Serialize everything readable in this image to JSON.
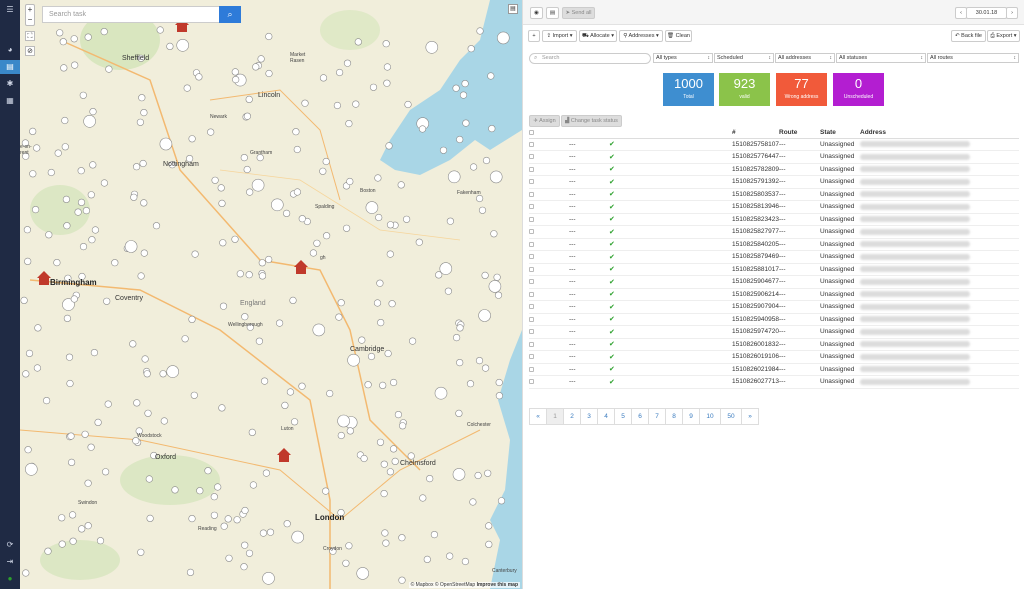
{
  "nav": {
    "icons": [
      "menu-icon",
      "globe-icon",
      "list-icon",
      "settings-icon",
      "calendar-icon",
      "refresh-icon",
      "logout-icon",
      "status-icon"
    ]
  },
  "map": {
    "search_placeholder": "Search task",
    "zoom_in": "+",
    "zoom_out": "−",
    "attribution": "© Mapbox © OpenStreetMap",
    "attribution_link": "Improve this map",
    "labels": {
      "sheffield": "Sheffield",
      "lincoln": "Lincoln",
      "nottingham": "Nottingham",
      "birmingham": "Birmingham",
      "coventry": "Coventry",
      "england": "England",
      "cambridge": "Cambridge",
      "oxford": "Oxford",
      "chelmsford": "Chelmsford",
      "london": "London",
      "colchester": "Colchester",
      "canterbury": "Canterbury",
      "spalding": "Spalding",
      "peterborough": "gh",
      "wellingborough": "Wellingborough",
      "northampton": "Northampton",
      "fakenham": "Fakenham",
      "stoke": "e-on-\nrent",
      "woodstock": "Woodstock",
      "swindon": "Swindon",
      "reading": "Reading",
      "croydon": "Croydon",
      "marketrasen": "Market\nRasen",
      "boston": "Boston",
      "newark": "Newark",
      "grantham": "Grantham",
      "luton": "Luton"
    }
  },
  "toolbar": {
    "send_all": "Send all",
    "date": "30.01.18",
    "import": "Import",
    "allocate": "Allocate",
    "addresses": "Addresses",
    "clean": "Clean",
    "back_file": "Back file",
    "export": "Export"
  },
  "filters": {
    "search_placeholder": "Search",
    "types": "All types",
    "scheduled": "Scheduled",
    "addresses": "All addresses",
    "statuses": "All statuses",
    "routes": "All routes"
  },
  "stats": [
    {
      "value": "1000",
      "label": "Total",
      "color": "#3e8ed0"
    },
    {
      "value": "923",
      "label": "valid",
      "color": "#8bc34a"
    },
    {
      "value": "77",
      "label": "Wrong address",
      "color": "#f15a3a"
    },
    {
      "value": "0",
      "label": "Unscheduled",
      "color": "#b31ed1"
    }
  ],
  "actions": {
    "assign": "Assign",
    "change_status": "Change task status"
  },
  "table": {
    "headers": {
      "number": "#",
      "route": "Route",
      "state": "State",
      "address": "Address"
    },
    "rows": [
      {
        "id": "1510825758107",
        "route": "---",
        "state": "Unassigned"
      },
      {
        "id": "1510825776447",
        "route": "---",
        "state": "Unassigned"
      },
      {
        "id": "1510825782809",
        "route": "---",
        "state": "Unassigned"
      },
      {
        "id": "1510825791392",
        "route": "---",
        "state": "Unassigned"
      },
      {
        "id": "1510825803537",
        "route": "---",
        "state": "Unassigned"
      },
      {
        "id": "1510825813946",
        "route": "---",
        "state": "Unassigned"
      },
      {
        "id": "1510825823423",
        "route": "---",
        "state": "Unassigned"
      },
      {
        "id": "1510825827977",
        "route": "---",
        "state": "Unassigned"
      },
      {
        "id": "1510825840205",
        "route": "---",
        "state": "Unassigned"
      },
      {
        "id": "1510825879469",
        "route": "---",
        "state": "Unassigned"
      },
      {
        "id": "1510825881017",
        "route": "---",
        "state": "Unassigned"
      },
      {
        "id": "1510825904677",
        "route": "---",
        "state": "Unassigned"
      },
      {
        "id": "1510825906214",
        "route": "---",
        "state": "Unassigned"
      },
      {
        "id": "1510825907904",
        "route": "---",
        "state": "Unassigned"
      },
      {
        "id": "1510825940958",
        "route": "---",
        "state": "Unassigned"
      },
      {
        "id": "1510825974720",
        "route": "---",
        "state": "Unassigned"
      },
      {
        "id": "1510826001832",
        "route": "---",
        "state": "Unassigned"
      },
      {
        "id": "1510826019106",
        "route": "---",
        "state": "Unassigned"
      },
      {
        "id": "1510826021984",
        "route": "---",
        "state": "Unassigned"
      },
      {
        "id": "1510826027713",
        "route": "---",
        "state": "Unassigned"
      }
    ],
    "dash": "---"
  },
  "pagination": {
    "prev": "«",
    "next": "»",
    "pages": [
      "1",
      "2",
      "3",
      "4",
      "5",
      "6",
      "7",
      "8",
      "9",
      "10",
      "50"
    ],
    "current": "1"
  }
}
